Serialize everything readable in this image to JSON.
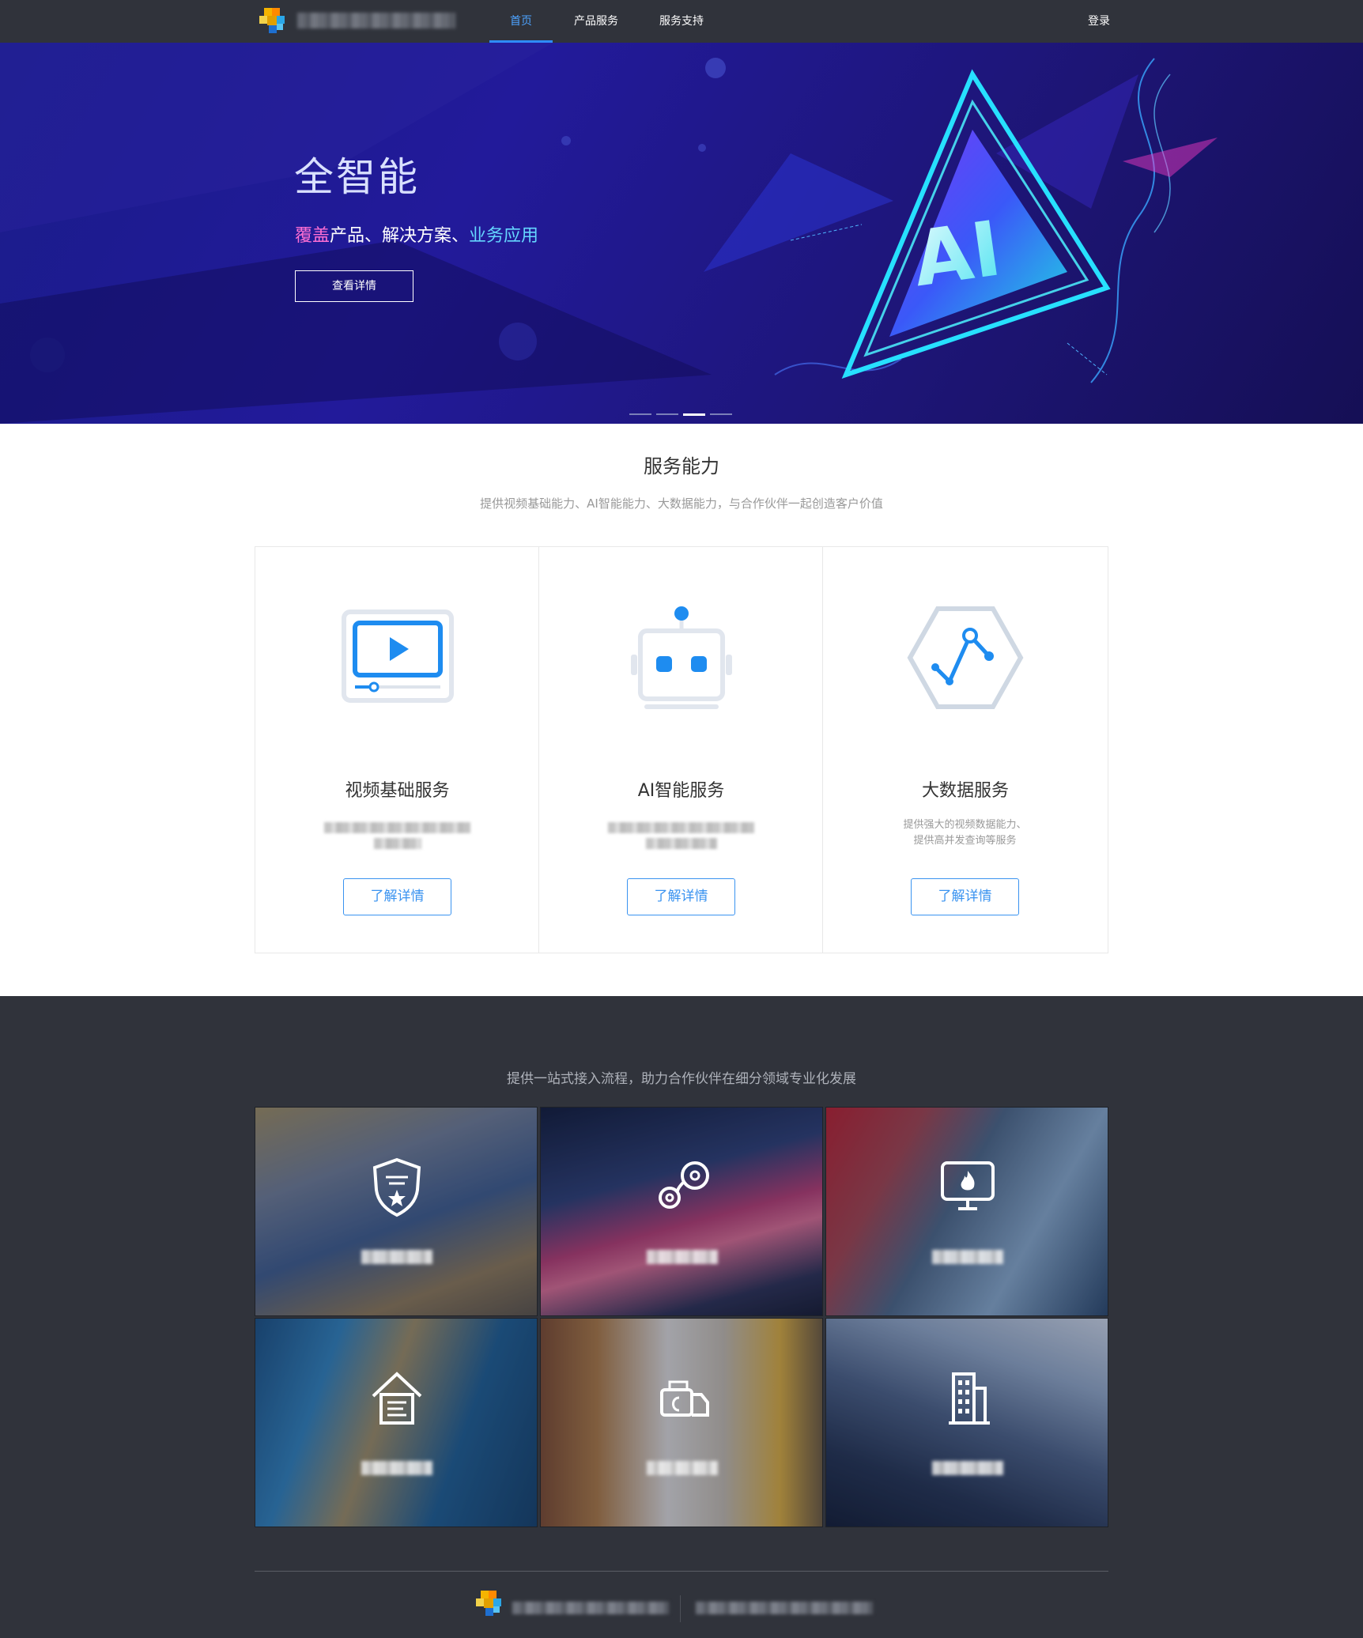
{
  "nav": {
    "items": [
      {
        "label": "首页",
        "active": true
      },
      {
        "label": "产品服务",
        "active": false
      },
      {
        "label": "服务支持",
        "active": false
      }
    ],
    "login": "登录"
  },
  "hero": {
    "title": "全智能",
    "subtitle_part1": "覆盖",
    "subtitle_part2": "产品、解决方案、",
    "subtitle_part3": "业务应用",
    "button": "查看详情",
    "art_text": "AI",
    "slides_total": 4,
    "slide_active": 3
  },
  "services": {
    "title": "服务能力",
    "description": "提供视频基础能力、AI智能能力、大数据能力，与合作伙伴一起创造客户价值",
    "cards": [
      {
        "icon": "video-player-icon",
        "title": "视频基础服务",
        "desc_line1": "",
        "desc_line2": "",
        "button": "了解详情"
      },
      {
        "icon": "robot-icon",
        "title": "AI智能服务",
        "desc_line1": "",
        "desc_line2": "",
        "button": "了解详情"
      },
      {
        "icon": "chart-hexagon-icon",
        "title": "大数据服务",
        "desc_line1": "提供强大的视频数据能力、",
        "desc_line2": "提供高并发查询等服务",
        "button": "了解详情"
      }
    ]
  },
  "solutions": {
    "description": "提供一站式接入流程，助力合作伙伴在细分领域专业化发展",
    "tiles": [
      {
        "icon": "police-shield-icon"
      },
      {
        "icon": "traffic-link-icon"
      },
      {
        "icon": "fire-monitor-icon"
      },
      {
        "icon": "home-security-icon"
      },
      {
        "icon": "logistics-truck-icon"
      },
      {
        "icon": "building-icon"
      }
    ]
  },
  "colors": {
    "topbar": "#30333b",
    "accent": "#3a93f0",
    "hero_bg": "#1d1580",
    "dark_section": "#30333b"
  }
}
